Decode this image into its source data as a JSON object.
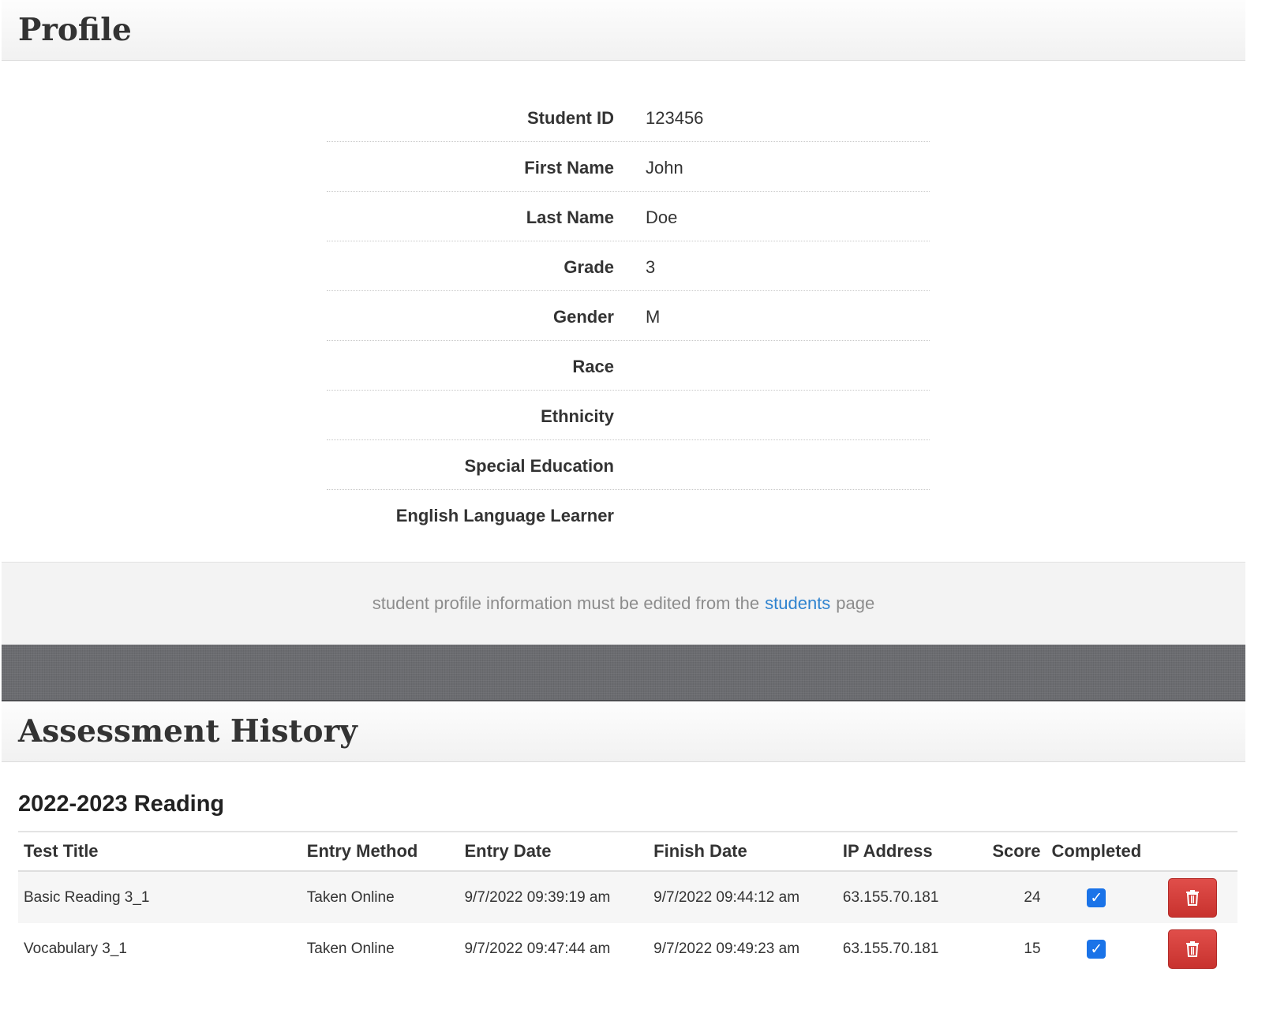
{
  "profile": {
    "title": "Profile",
    "fields": [
      {
        "label": "Student ID",
        "value": "123456"
      },
      {
        "label": "First Name",
        "value": "John"
      },
      {
        "label": "Last Name",
        "value": "Doe"
      },
      {
        "label": "Grade",
        "value": "3"
      },
      {
        "label": "Gender",
        "value": "M"
      },
      {
        "label": "Race",
        "value": ""
      },
      {
        "label": "Ethnicity",
        "value": ""
      },
      {
        "label": "Special Education",
        "value": ""
      },
      {
        "label": "English Language Learner",
        "value": ""
      }
    ],
    "note_prefix": "student profile information must be edited from the",
    "note_link": "students",
    "note_suffix": "page"
  },
  "history": {
    "title": "Assessment History",
    "section_title": "2022-2023 Reading",
    "columns": [
      "Test Title",
      "Entry Method",
      "Entry Date",
      "Finish Date",
      "IP Address",
      "Score",
      "Completed"
    ],
    "rows": [
      {
        "test_title": "Basic Reading 3_1",
        "entry_method": "Taken Online",
        "entry_date": "9/7/2022 09:39:19 am",
        "finish_date": "9/7/2022 09:44:12 am",
        "ip": "63.155.70.181",
        "score": "24",
        "completed": true
      },
      {
        "test_title": "Vocabulary 3_1",
        "entry_method": "Taken Online",
        "entry_date": "9/7/2022 09:47:44 am",
        "finish_date": "9/7/2022 09:49:23 am",
        "ip": "63.155.70.181",
        "score": "15",
        "completed": true
      }
    ]
  },
  "icons": {
    "delete": "trash-icon",
    "completed": "checkbox-checked-icon"
  },
  "colors": {
    "link": "#2f83cf",
    "delete_button": "#d43f3a",
    "checkbox": "#1a73e8"
  }
}
